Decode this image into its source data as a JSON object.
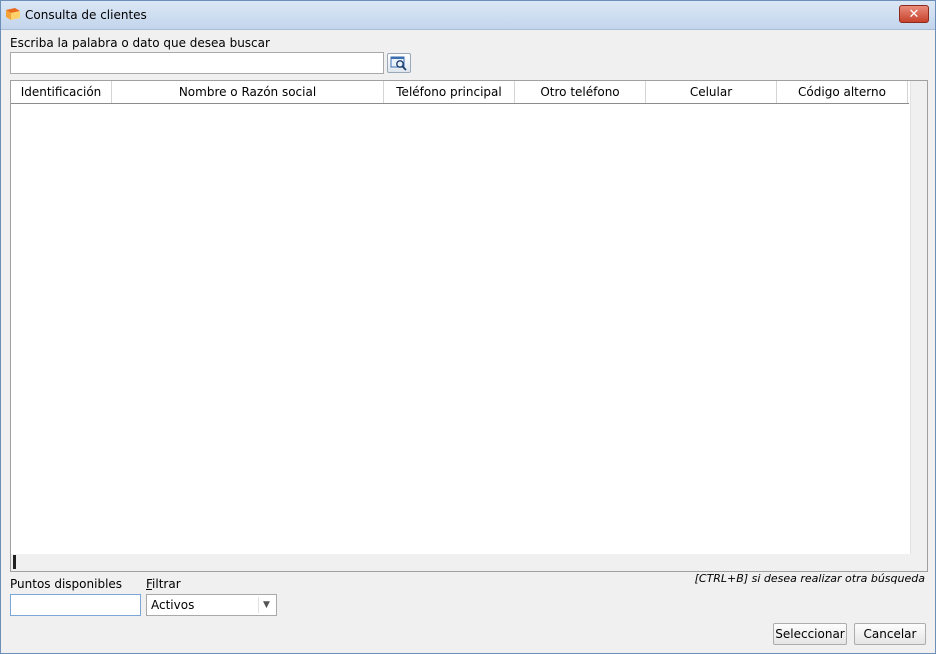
{
  "window": {
    "title": "Consulta de clientes",
    "close_label": "✕"
  },
  "search": {
    "label": "Escriba la palabra o dato que desea buscar",
    "value": "",
    "placeholder": ""
  },
  "grid": {
    "columns": [
      "Identificación",
      "Nombre o Razón social",
      "Teléfono principal",
      "Otro teléfono",
      "Celular",
      "Código alterno"
    ],
    "rows": []
  },
  "points": {
    "label": "Puntos disponibles",
    "value": ""
  },
  "filter": {
    "label_first": "F",
    "label_rest": "iltrar",
    "selected": "Activos"
  },
  "hint": "[CTRL+B] si desea realizar otra búsqueda",
  "buttons": {
    "select": "Seleccionar",
    "cancel": "Cancelar"
  }
}
